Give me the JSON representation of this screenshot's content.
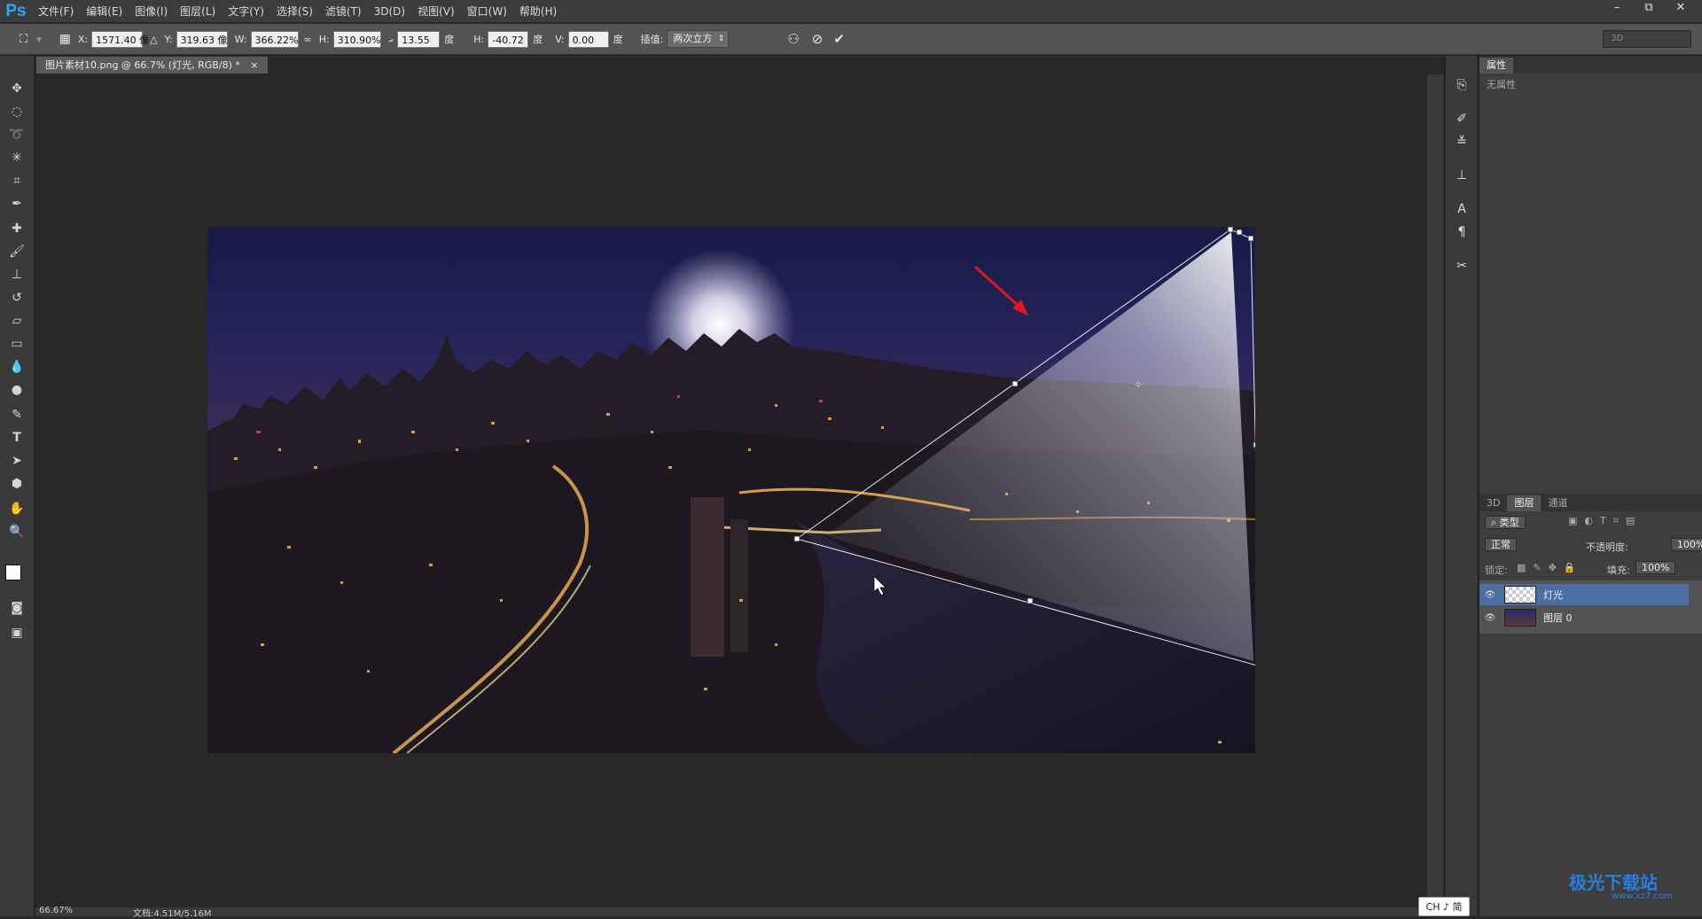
{
  "app": {
    "logo": "Ps"
  },
  "menu": [
    "文件(F)",
    "编辑(E)",
    "图像(I)",
    "图层(L)",
    "文字(Y)",
    "选择(S)",
    "滤镜(T)",
    "3D(D)",
    "视图(V)",
    "窗口(W)",
    "帮助(H)"
  ],
  "window_controls": [
    "–",
    "⧉",
    "✕"
  ],
  "options": {
    "x_label": "X:",
    "x_value": "1571.40 像",
    "y_label": "Y:",
    "y_value": "319.63 像",
    "w_label": "W:",
    "w_value": "366.22%",
    "h_label": "H:",
    "h_value": "310.90%",
    "angle_value": "13.55",
    "angle_unit": "度",
    "hskew_label": "H:",
    "hskew_value": "-40.72",
    "hskew_unit": "度",
    "vskew_label": "V:",
    "vskew_value": "0.00",
    "vskew_unit": "度",
    "interp_label": "插值:",
    "interp_value": "两次立方",
    "workspace": "3D"
  },
  "document": {
    "tab_title": "图片素材10.png @ 66.7% (灯光, RGB/8) *",
    "close": "×"
  },
  "status": {
    "zoom": "66.67%",
    "doc_info": "文档:4.51M/5.16M"
  },
  "properties": {
    "tab": "属性",
    "content": "无属性"
  },
  "layers_panel": {
    "tabs": [
      "3D",
      "图层",
      "通道"
    ],
    "filter_label": "类型",
    "blend_mode": "正常",
    "opacity_label": "不透明度:",
    "opacity_value": "100%",
    "lock_label": "锁定:",
    "fill_label": "填充:",
    "fill_value": "100%",
    "layers": [
      {
        "name": "灯光",
        "selected": true
      },
      {
        "name": "图层 0",
        "selected": false
      }
    ]
  },
  "ime": "CH ♪ 简",
  "watermark": {
    "text": "极光下载站",
    "url": "www.xz7.com"
  },
  "colors": {
    "accent": "#31a8ff",
    "selected_layer": "#4b6fa3",
    "arrow": "#e3171b"
  }
}
